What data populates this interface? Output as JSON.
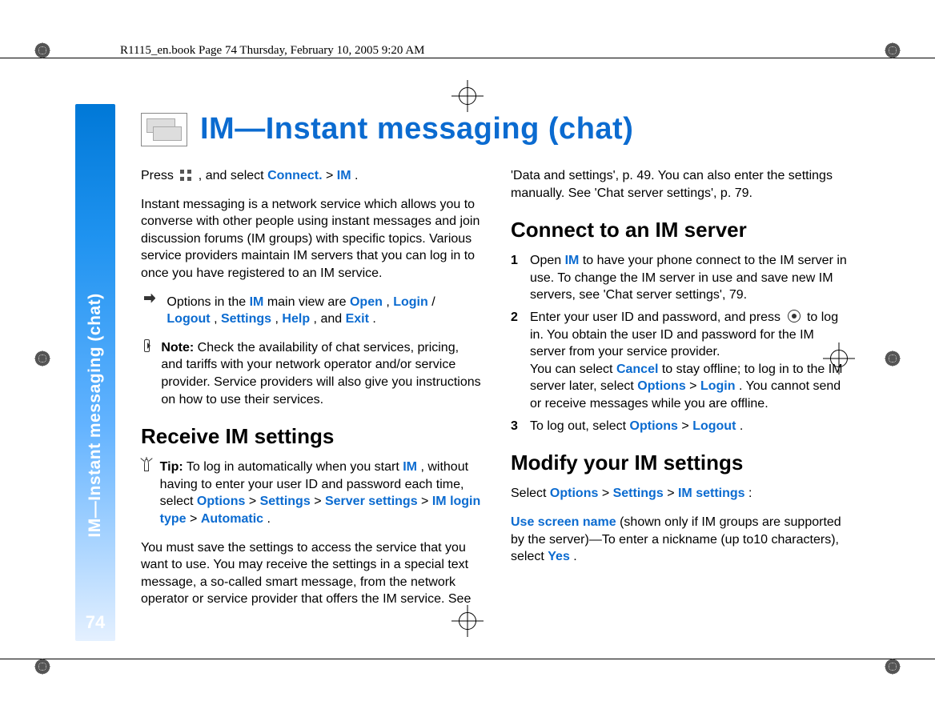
{
  "running_head": "R1115_en.book  Page 74  Thursday, February 10, 2005  9:20 AM",
  "sidebar": {
    "label": "IM—Instant messaging (chat)",
    "page_number": "74"
  },
  "title": "IM—Instant messaging (chat)",
  "col1": {
    "press_pre": "Press ",
    "press_post": ", and select ",
    "connect": "Connect.",
    "gt1": " > ",
    "im": "IM",
    "press_end": ".",
    "intro": "Instant messaging is a network service which allows you to converse with other people using instant messages and join discussion forums (IM groups) with specific topics. Various service providers maintain IM servers that you can log in to once you have registered to an IM service.",
    "options_pre": "Options in the ",
    "options_im": "IM",
    "options_mid": " main view are ",
    "open": "Open",
    "sep1": ", ",
    "login": "Login",
    "slash": "/",
    "logout": "Logout",
    "sep2": ", ",
    "settings": "Settings",
    "sep3": ", ",
    "help": "Help",
    "and": ", and ",
    "exit": "Exit",
    "options_end": ".",
    "note_bold": "Note:",
    "note_text": " Check the availability of chat services, pricing, and tariffs with your network operator and/or service provider. Service providers will also give you instructions on how to use their services.",
    "h_receive": "Receive IM settings",
    "tip_bold": "Tip:",
    "tip_pre": " To log in automatically when you start ",
    "tip_im": "IM",
    "tip_mid": ", without having to enter your user ID and password each time, select ",
    "tip_options": "Options",
    "tip_gt1": " > ",
    "tip_settings": "Settings",
    "tip_gt2": " > ",
    "tip_server": "Server settings",
    "tip_gt3": " > ",
    "tip_login_type": "IM login type",
    "tip_gt4": " > ",
    "tip_auto": "Automatic",
    "tip_end": ".",
    "must_save": "You must save the settings to access the service that you want to use. You may receive the settings in a special text message, a so-called smart message, from the network operator or service provider that offers the IM service. See"
  },
  "col2": {
    "cont": "'Data and settings', p. 49. You can also enter the settings manually. See 'Chat server settings', p. 79.",
    "h_connect": "Connect to an IM server",
    "s1_pre": "Open ",
    "s1_im": "IM",
    "s1_post": " to have your phone connect to the IM server in use. To change the IM server in use and save new IM servers, see 'Chat server settings', 79.",
    "s2a_pre": "Enter your user ID and password, and press ",
    "s2a_post": " to log in. You obtain the user ID and password for the IM server from your service provider.",
    "s2b_pre": "You can select ",
    "s2b_cancel": "Cancel",
    "s2b_mid": " to stay offline; to log in to the IM server later, select ",
    "s2b_options": "Options",
    "s2b_gt": " > ",
    "s2b_login": "Login",
    "s2b_post": ". You cannot send or receive messages while you are offline.",
    "s3_pre": "To log out, select ",
    "s3_options": "Options",
    "s3_gt": " > ",
    "s3_logout": "Logout",
    "s3_end": ".",
    "h_modify": "Modify your IM settings",
    "mod_pre": "Select ",
    "mod_options": "Options",
    "mod_gt1": " > ",
    "mod_settings": "Settings",
    "mod_gt2": " > ",
    "mod_im_settings": "IM settings",
    "mod_end": ":",
    "use_name": "Use screen name",
    "use_mid": " (shown only if IM groups are supported by the server)—To enter a nickname (up to10 characters), select ",
    "use_yes": "Yes",
    "use_end": "."
  }
}
